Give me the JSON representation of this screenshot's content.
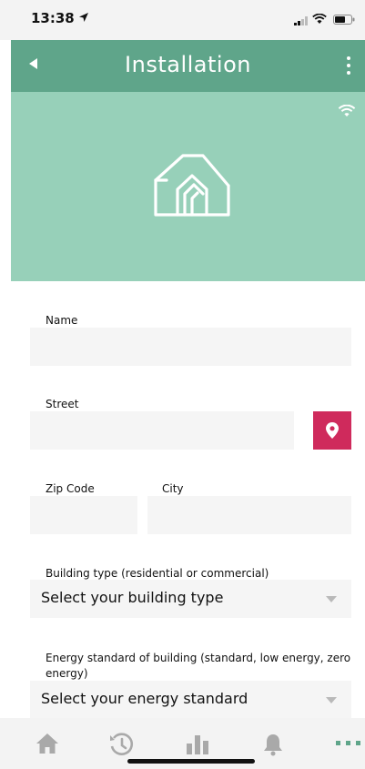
{
  "status_bar": {
    "time": "13:38"
  },
  "header": {
    "title": "Installation",
    "back_icon": "back-arrow-icon",
    "menu_icon": "more-vertical-icon"
  },
  "hero": {
    "background": "#97d0b9",
    "icons": [
      "wifi-icon",
      "house-icon"
    ]
  },
  "form": {
    "name": {
      "label": "Name",
      "value": ""
    },
    "street": {
      "label": "Street",
      "value": ""
    },
    "zip": {
      "label": "Zip Code",
      "value": ""
    },
    "city": {
      "label": "City",
      "value": ""
    },
    "building_type": {
      "label": "Building type (residential or commercial)",
      "selected": "Select your building type"
    },
    "energy_standard": {
      "label": "Energy standard of building (standard, low energy, zero energy)",
      "selected": "Select your energy standard"
    }
  },
  "bottom_nav": {
    "items": [
      "home-icon",
      "history-icon",
      "statistics-icon",
      "notifications-icon",
      "more-horizontal-icon"
    ],
    "active_color": "#5fa58a"
  },
  "colors": {
    "header": "#5fa58a",
    "accent": "#cf2a5c",
    "field_bg": "#f5f5f5"
  }
}
